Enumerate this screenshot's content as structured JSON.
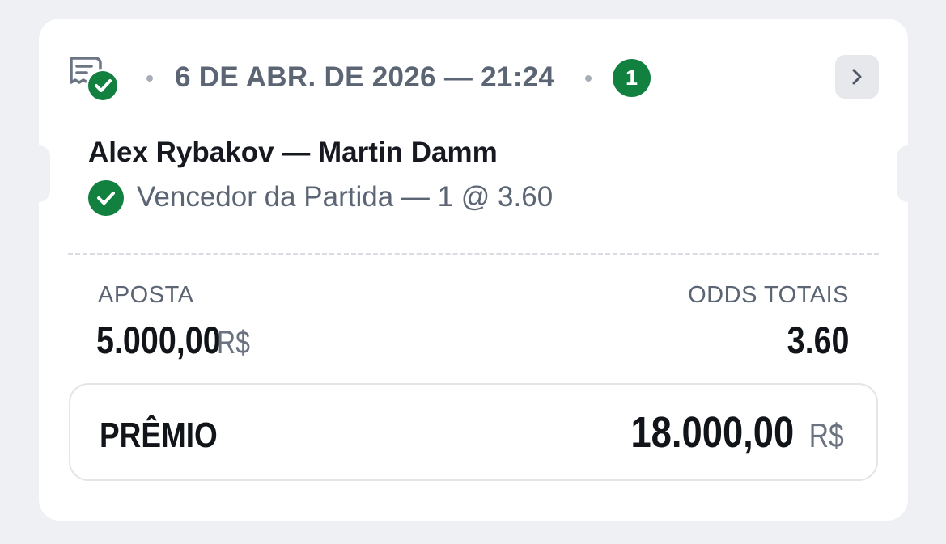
{
  "bet": {
    "date_time": "6 DE ABR. DE 2026 — 21:24",
    "selections_count": "1",
    "match": "Alex Rybakov — Martin Damm",
    "selection": "Vencedor da Partida — 1 @ 3.60",
    "stake_label": "APOSTA",
    "stake_value": "5.000,00",
    "currency": "R$",
    "odds_label": "ODDS TOTAIS",
    "odds_value": "3.60",
    "prize_label": "PRÊMIO",
    "prize_value": "18.000,00"
  },
  "icons": {
    "ticket": "ticket-check-icon",
    "chevron": "chevron-right-icon",
    "selection_status": "check-circle-icon"
  },
  "colors": {
    "success": "#12803f",
    "muted_text": "#5b6574",
    "background": "#eff0f3"
  }
}
